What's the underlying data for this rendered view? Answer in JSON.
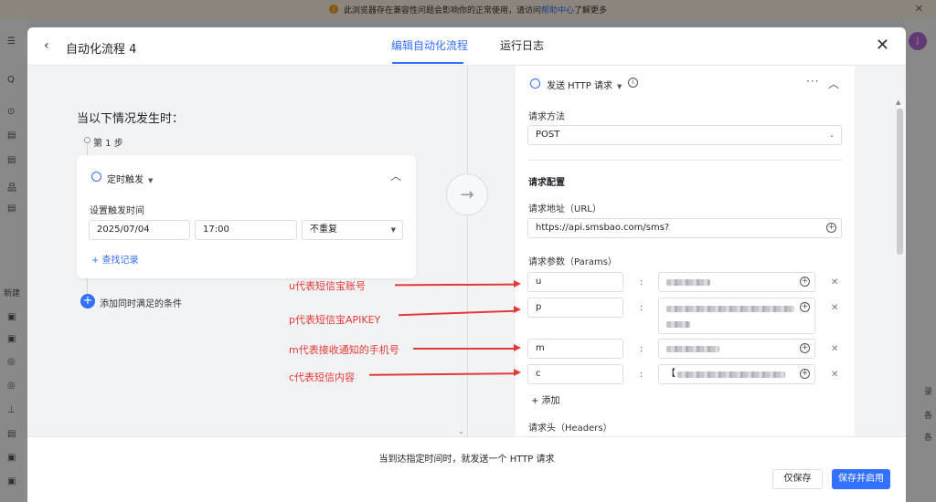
{
  "banner": {
    "text_before": "此浏览器存在兼容性问题会影响你的正常使用，请访问",
    "link": "帮助中心",
    "text_after": "了解更多",
    "warn_glyph": "!"
  },
  "background": {
    "avatar": "J",
    "side_glyphs": [
      "☰",
      "Q",
      "⊙",
      "▤",
      "▤",
      "品",
      "▤",
      "新建",
      "▣",
      "▣",
      "◎",
      "◎",
      "⊥",
      "▤",
      "▣",
      "▣"
    ],
    "right_labels": [
      "录",
      "各",
      "各"
    ]
  },
  "modal": {
    "title": "自动化流程 4",
    "tabs": [
      "编辑自动化流程",
      "运行日志"
    ]
  },
  "left": {
    "when_title": "当以下情况发生时：",
    "step_label": "第 1 步",
    "trigger": {
      "type": "定时触发",
      "set_time_label": "设置触发时间",
      "date": "2025/07/04",
      "time": "17:00",
      "repeat": "不重复",
      "find_link": "+ 查找记录"
    },
    "add_condition": "添加同时满足的条件"
  },
  "right": {
    "action_title": "发送 HTTP 请求",
    "method_label": "请求方法",
    "method_value": "POST",
    "config_section": "请求配置",
    "url_label": "请求地址（URL）",
    "url_value": "https://api.smsbao.com/sms?",
    "params_label": "请求参数（Params）",
    "params": [
      {
        "key": "u",
        "value_prefix": ""
      },
      {
        "key": "p",
        "value_prefix": ""
      },
      {
        "key": "m",
        "value_prefix": ""
      },
      {
        "key": "c",
        "value_prefix": "【"
      }
    ],
    "add_param": "+ 添加",
    "headers_label": "请求头（Headers）"
  },
  "annotations": [
    "u代表短信宝账号",
    "p代表短信宝APIKEY",
    "m代表接收通知的手机号",
    "c代表短信内容"
  ],
  "footer": {
    "summary": "当到达指定时间时，就发送一个 HTTP 请求",
    "save": "仅保存",
    "save_enable": "保存并启用"
  },
  "colors": {
    "accent": "#3370ff",
    "annotation": "#e53935"
  }
}
